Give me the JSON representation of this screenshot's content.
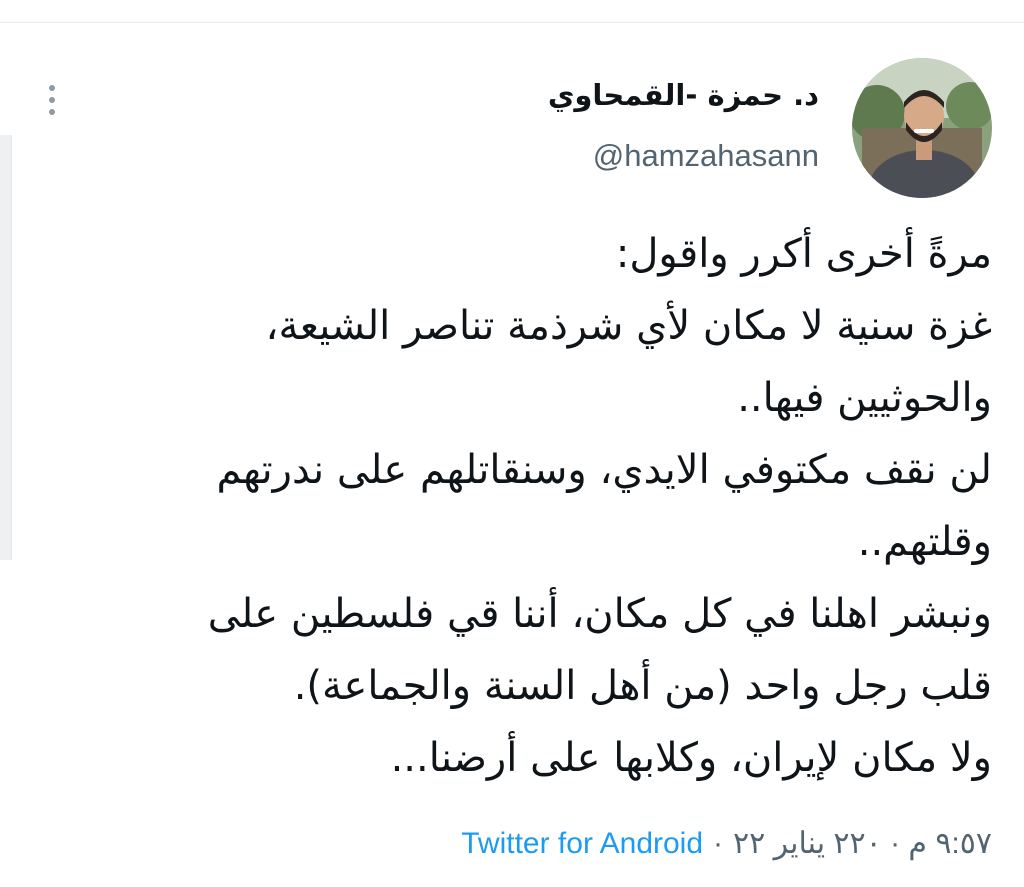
{
  "tweet": {
    "author": {
      "display_name": "د. حمزة -القمحاوي",
      "handle": "@hamzahasann",
      "avatar_icon": "profile-photo"
    },
    "text_lines": [
      "مرةً أخرى أكرر واقول:",
      "غزة سنية لا مكان لأي شرذمة تناصر الشيعة،",
      "والحوثيين فيها..",
      "لن نقف مكتوفي الايدي، وسنقاتلهم على ندرتهم",
      "وقلتهم..",
      "ونبشر اهلنا في كل مكان، أننا قي فلسطين على",
      "قلب رجل واحد (من أهل السنة والجماعة).",
      "ولا مكان لإيران، وكلابها على أرضنا..."
    ],
    "timestamp": "٩:٥٧ م · ٢٢٠ يناير ٢٢",
    "separator": "·",
    "source": "Twitter for Android"
  },
  "colors": {
    "text": "#0f1419",
    "secondary": "#536471",
    "link": "#1d9bf0"
  }
}
